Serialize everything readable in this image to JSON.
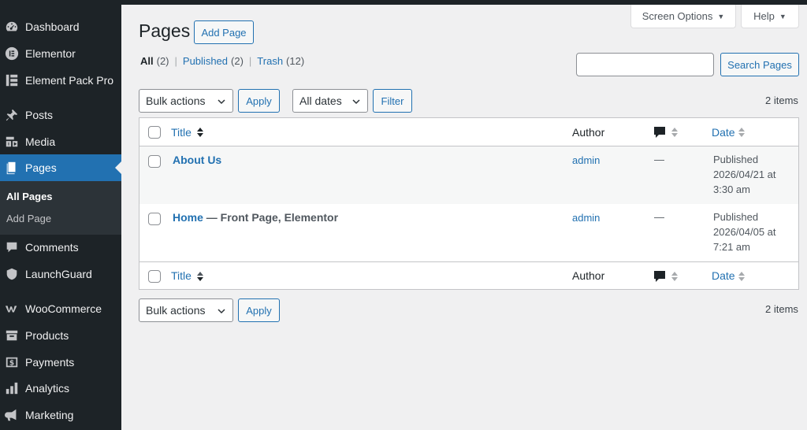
{
  "sidebar": {
    "items": [
      {
        "label": "Dashboard"
      },
      {
        "label": "Elementor"
      },
      {
        "label": "Element Pack Pro"
      },
      {
        "label": "Posts"
      },
      {
        "label": "Media"
      },
      {
        "label": "Pages"
      },
      {
        "label": "Comments"
      },
      {
        "label": "LaunchGuard"
      },
      {
        "label": "WooCommerce"
      },
      {
        "label": "Products"
      },
      {
        "label": "Payments"
      },
      {
        "label": "Analytics"
      },
      {
        "label": "Marketing"
      }
    ],
    "submenu": [
      {
        "label": "All Pages"
      },
      {
        "label": "Add Page"
      }
    ]
  },
  "header": {
    "screen_options": "Screen Options",
    "help": "Help",
    "title": "Pages",
    "add_page": "Add Page"
  },
  "filters": {
    "all": "All",
    "all_count": "(2)",
    "published": "Published",
    "published_count": "(2)",
    "trash": "Trash",
    "trash_count": "(12)",
    "search_button": "Search Pages",
    "search_placeholder": ""
  },
  "tablenav": {
    "bulk_actions": "Bulk actions",
    "apply": "Apply",
    "all_dates": "All dates",
    "filter": "Filter",
    "items": "2 items"
  },
  "table": {
    "columns": {
      "title": "Title",
      "author": "Author",
      "date": "Date"
    },
    "rows": [
      {
        "title": "About Us",
        "state": "",
        "author": "admin",
        "comments": "—",
        "status": "Published",
        "date": "2026/04/21 at",
        "time": "3:30 am"
      },
      {
        "title": "Home",
        "state": " — Front Page, Elementor",
        "author": "admin",
        "comments": "—",
        "status": "Published",
        "date": "2026/04/05 at",
        "time": "7:21 am"
      }
    ]
  },
  "colors": {
    "sidebar_bg": "#1d2327",
    "accent": "#2271b1",
    "page_bg": "#f0f0f1"
  }
}
